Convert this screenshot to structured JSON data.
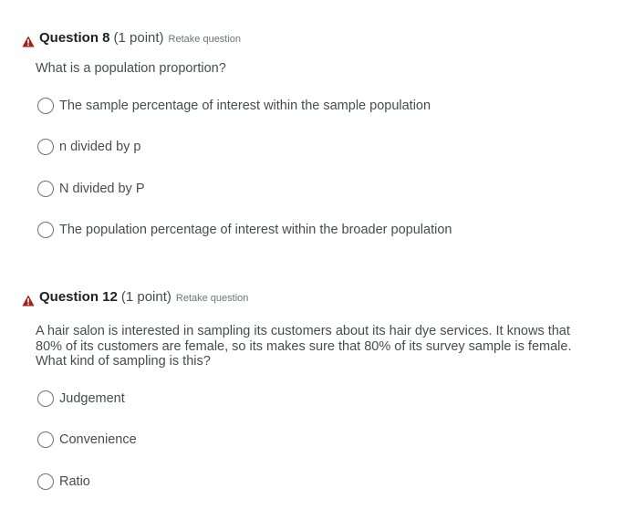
{
  "questions": [
    {
      "title": "Question 8",
      "points": "(1 point)",
      "retake": "Retake question",
      "prompt": "What is a population proportion?",
      "options": [
        "The sample percentage of interest within the sample population",
        "n divided by p",
        "N divided by P",
        "The population percentage of interest within the broader population"
      ]
    },
    {
      "title": "Question 12",
      "points": "(1 point)",
      "retake": "Retake question",
      "prompt": "A hair salon is interested in sampling its customers about its hair dye services. It knows that 80% of its customers are female, so its makes sure that 80% of its survey sample is female. What kind of sampling is this?",
      "options": [
        "Judgement",
        "Convenience",
        "Ratio"
      ]
    }
  ],
  "colors": {
    "warning": "#a2211a",
    "text": "#494c4e",
    "title": "#202122"
  }
}
